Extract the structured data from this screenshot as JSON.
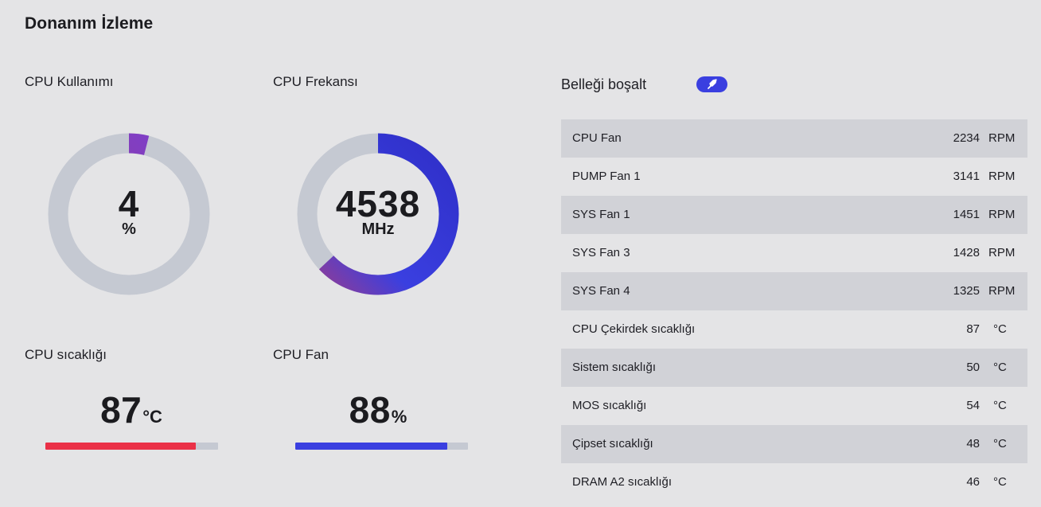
{
  "page": {
    "title": "Donanım İzleme"
  },
  "colors": {
    "accent_blue": "#3a3fe0",
    "accent_purple": "#9b3c8c",
    "temp_red": "#ea3047",
    "track_gray": "#c5c9d2",
    "row_shade": "#d1d2d7"
  },
  "cpu_usage": {
    "label": "CPU Kullanımı",
    "value": "4",
    "unit": "%",
    "fraction": 0.04
  },
  "cpu_frequency": {
    "label": "CPU Frekansı",
    "value": "4538",
    "unit": "MHz",
    "fraction": 0.63
  },
  "cpu_temperature": {
    "label": "CPU sıcaklığı",
    "value": "87",
    "unit": "°C",
    "fraction": 0.87
  },
  "cpu_fan": {
    "label": "CPU Fan",
    "value": "88",
    "unit": "%",
    "fraction": 0.88
  },
  "free_memory": {
    "label": "Belleği boşalt",
    "button_icon": "rocket-icon"
  },
  "sensors": [
    {
      "name": "CPU Fan",
      "value": "2234",
      "unit": "RPM"
    },
    {
      "name": "PUMP Fan 1",
      "value": "3141",
      "unit": "RPM"
    },
    {
      "name": "SYS Fan 1",
      "value": "1451",
      "unit": "RPM"
    },
    {
      "name": "SYS Fan 3",
      "value": "1428",
      "unit": "RPM"
    },
    {
      "name": "SYS Fan 4",
      "value": "1325",
      "unit": "RPM"
    },
    {
      "name": "CPU Çekirdek sıcaklığı",
      "value": "87",
      "unit": "°C"
    },
    {
      "name": "Sistem sıcaklığı",
      "value": "50",
      "unit": "°C"
    },
    {
      "name": "MOS sıcaklığı",
      "value": "54",
      "unit": "°C"
    },
    {
      "name": "Çipset sıcaklığı",
      "value": "48",
      "unit": "°C"
    },
    {
      "name": "DRAM A2 sıcaklığı",
      "value": "46",
      "unit": "°C"
    }
  ]
}
